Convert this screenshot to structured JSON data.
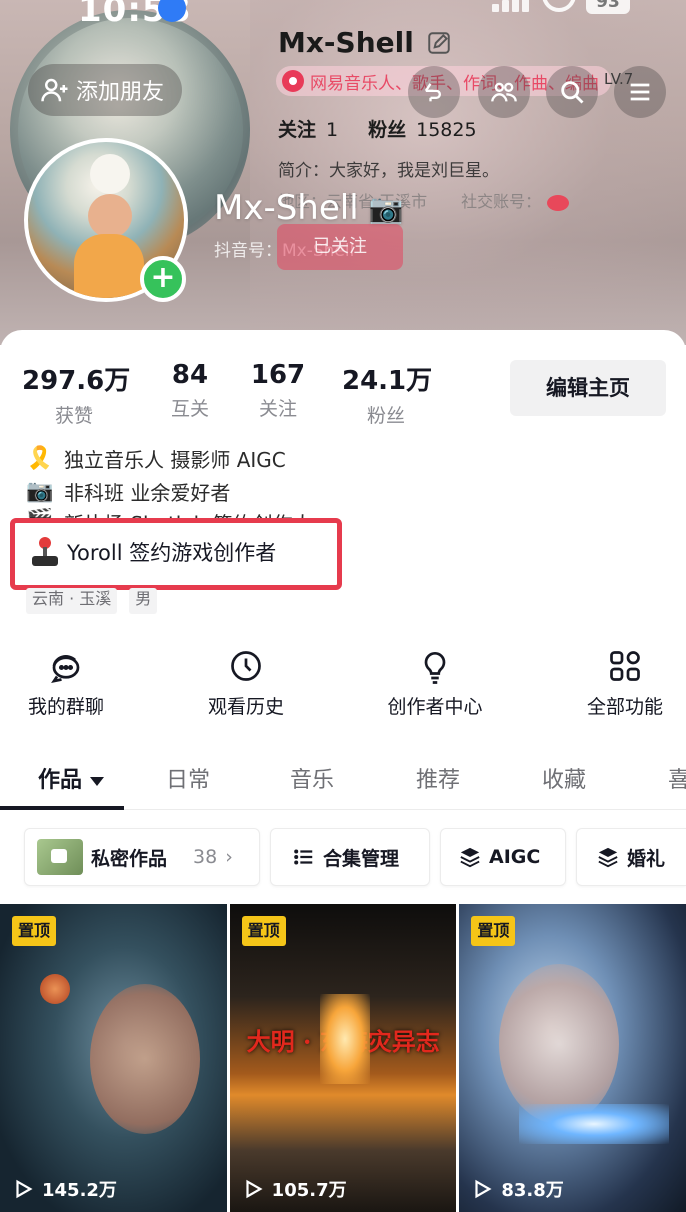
{
  "status_bar": {
    "time": "10:58",
    "battery": "93"
  },
  "header": {
    "add_friend_label": "添加朋友",
    "name": "Mx-Shell",
    "music_badge": "网易音乐人、歌手、作词、作曲、编曲",
    "level": "LV.7",
    "follow_label": "关注",
    "follow_count": "1",
    "fans_label": "粉丝",
    "fans_count": "15825",
    "intro": "简介：大家好，我是刘巨星。",
    "area": "地区：云南省 玉溪市",
    "social": "社交账号：",
    "overlay_name": "Mx-Shell",
    "overlay_id": "抖音号：Mx-Shell",
    "overlay_follow_btn": "已关注"
  },
  "stats": [
    {
      "value": "297.6万",
      "label": "获赞"
    },
    {
      "value": "84",
      "label": "互关"
    },
    {
      "value": "167",
      "label": "关注"
    },
    {
      "value": "24.1万",
      "label": "粉丝"
    }
  ],
  "edit_home_label": "编辑主页",
  "bio": {
    "lines": [
      {
        "emoji": "🎗️",
        "text": "独立音乐人 摄影师 AIGC"
      },
      {
        "emoji": "📷",
        "text": "非科班 业余爱好者"
      },
      {
        "emoji": "🎬",
        "text": "新片场 Shotlab 签约创作人"
      }
    ],
    "highlight_text": "Yoroll 签约游戏创作者",
    "tags": [
      "云南 · 玉溪",
      "男"
    ]
  },
  "quick_actions": [
    {
      "label": "我的群聊",
      "icon": "chat-bubbles-icon"
    },
    {
      "label": "观看历史",
      "icon": "clock-icon"
    },
    {
      "label": "创作者中心",
      "icon": "lightbulb-icon"
    },
    {
      "label": "全部功能",
      "icon": "grid-icon"
    }
  ],
  "tabs": [
    "作品",
    "日常",
    "音乐",
    "推荐",
    "收藏",
    "喜欢"
  ],
  "chips": {
    "private_label": "私密作品",
    "private_count": "38",
    "collection_label": "合集管理",
    "aigc_label": "AIGC",
    "wedding_label": "婚礼"
  },
  "videos": [
    {
      "pin": "置顶",
      "plays": "145.2万",
      "caption": ""
    },
    {
      "pin": "置顶",
      "plays": "105.7万",
      "caption": "大明 · 东海灾异志"
    },
    {
      "pin": "置顶",
      "plays": "83.8万",
      "caption": ""
    }
  ]
}
